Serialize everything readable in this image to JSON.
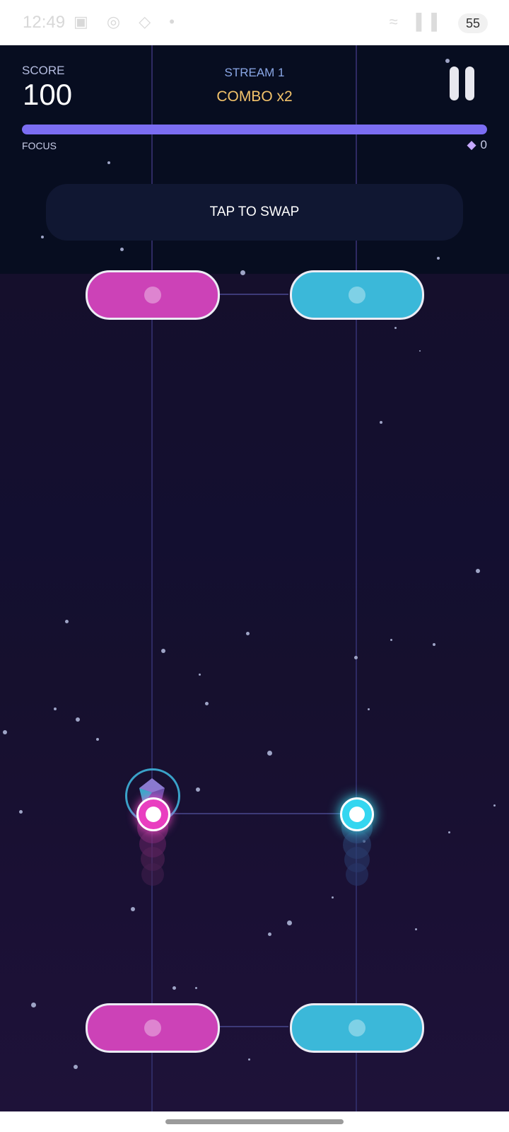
{
  "status_bar": {
    "time": "12:49",
    "icons": "▣ ◎ ◇ •",
    "signal": "≈ ▐▐",
    "battery": "55"
  },
  "hud": {
    "score_label": "SCORE",
    "score_value": "100",
    "stream_label": "STREAM 1",
    "combo_label": "COMBO x2",
    "focus_label": "FOCUS",
    "focus_level": 1.0,
    "gem_icon": "◆",
    "gem_count": "0",
    "pause_icon": "pause-icon"
  },
  "swap_button": {
    "label": "TAP TO SWAP"
  },
  "colors": {
    "magenta": "#cc42b7",
    "cyan": "#3bb8d9",
    "accent_bar": "#7b6df2",
    "combo": "#f3c36b"
  }
}
